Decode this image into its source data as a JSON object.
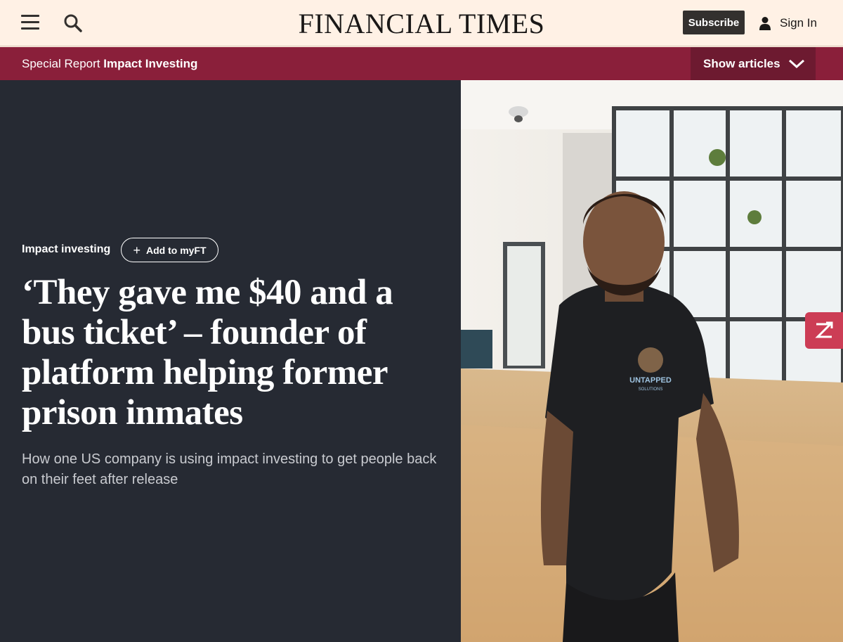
{
  "header": {
    "logo": "FINANCIAL TIMES",
    "subscribe_label": "Subscribe",
    "signin_label": "Sign In",
    "menu_icon": "hamburger-menu-icon",
    "search_icon": "search-icon",
    "user_icon": "user-icon"
  },
  "report_bar": {
    "prefix": "Special Report",
    "title": "Impact Investing",
    "show_articles_label": "Show articles",
    "chevron_icon": "chevron-down-icon",
    "background_color": "#8a1f3a"
  },
  "article": {
    "topic": "Impact investing",
    "myft_label": "Add to myFT",
    "headline": "‘They gave me $40 and a bus ticket’ – founder of platform helping former prison inmates",
    "standfirst": "How one US company is using impact investing to get people back on their feet after release",
    "panel_color": "#262a33"
  },
  "photo": {
    "shirt_text": "UNTAPPED",
    "shirt_subtext": "SOLUTIONS"
  },
  "floating_button_icon": "zigzag-icon"
}
